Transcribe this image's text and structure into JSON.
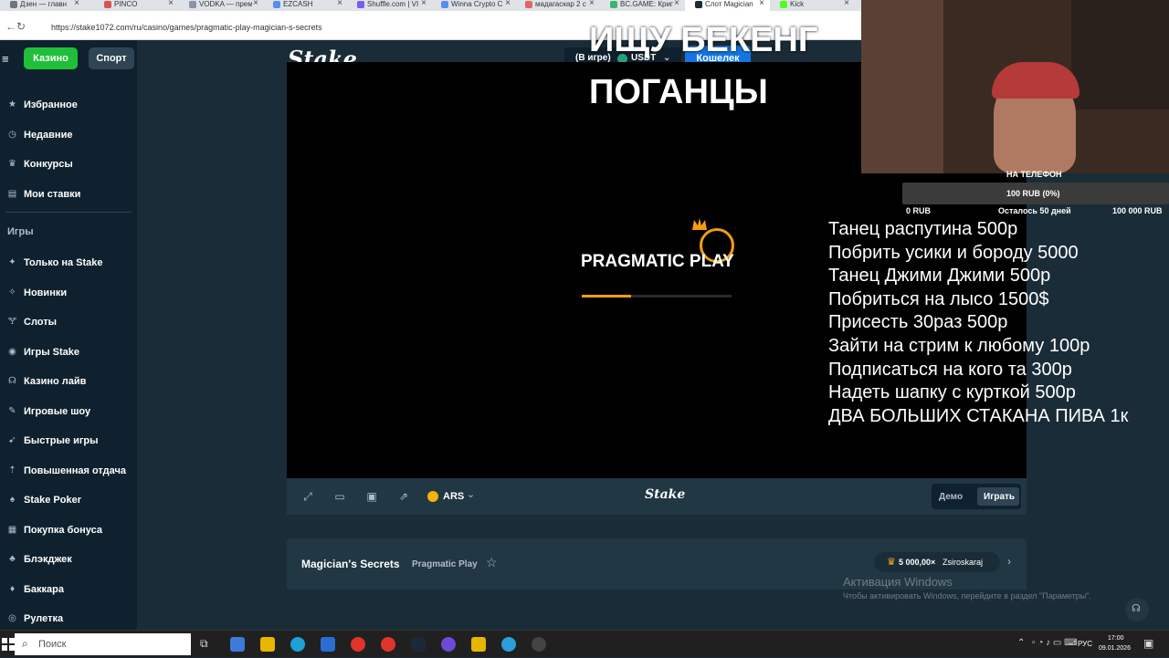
{
  "browser": {
    "tabs": [
      {
        "label": "Дзен — главн",
        "color": "#6f7680"
      },
      {
        "label": "PINCO",
        "color": "#d9534f"
      },
      {
        "label": "VODKA — прем",
        "color": "#8a94a6"
      },
      {
        "label": "EZCASH",
        "color": "#5b8def"
      },
      {
        "label": "Shuffle.com | VI",
        "color": "#7b5cf0"
      },
      {
        "label": "Winna Crypto C",
        "color": "#5b8def"
      },
      {
        "label": "мадагаскар 2 с",
        "color": "#e06666"
      },
      {
        "label": "BC.GAME: Крип",
        "color": "#3cb371"
      },
      {
        "label": "Слот Magician",
        "color": "#1a2c38"
      },
      {
        "label": "Kick",
        "color": "#53fc18"
      }
    ],
    "url": "https://stake1072.com/ru/casino/games/pragmatic-play-magician-s-secrets"
  },
  "site": {
    "casino_label": "Казино",
    "sport_label": "Спорт",
    "logo": "Stake",
    "balance_label": "(В игре)",
    "currency": "USDT",
    "wallet_label": "Кошелек",
    "nav_top": [
      {
        "label": "Избранное",
        "icon": "star-icon"
      },
      {
        "label": "Недавние",
        "icon": "clock-icon"
      },
      {
        "label": "Конкурсы",
        "icon": "trophy-icon"
      },
      {
        "label": "Мои ставки",
        "icon": "bets-icon"
      }
    ],
    "games_title": "Игры",
    "nav_games": [
      {
        "label": "Только на Stake",
        "icon": "stake-only-icon"
      },
      {
        "label": "Новинки",
        "icon": "sparkle-icon"
      },
      {
        "label": "Слоты",
        "icon": "slots-icon"
      },
      {
        "label": "Игры Stake",
        "icon": "stake-games-icon"
      },
      {
        "label": "Казино лайв",
        "icon": "live-casino-icon"
      },
      {
        "label": "Игровые шоу",
        "icon": "game-show-icon"
      },
      {
        "label": "Быстрые игры",
        "icon": "quick-games-icon"
      },
      {
        "label": "Повышенная отдача",
        "icon": "rtp-icon"
      },
      {
        "label": "Stake Poker",
        "icon": "poker-icon"
      },
      {
        "label": "Покупка бонуса",
        "icon": "bonus-buy-icon"
      },
      {
        "label": "Блэкджек",
        "icon": "blackjack-icon"
      },
      {
        "label": "Баккара",
        "icon": "baccarat-icon"
      },
      {
        "label": "Рулетка",
        "icon": "roulette-icon"
      }
    ],
    "game_loader_brand": "PRAGMATIC PLAY",
    "loader_progress": 0.33,
    "controls": {
      "currency": "ARS",
      "brand": "Stake",
      "demo_label": "Демо",
      "play_label": "Играть"
    },
    "game_title": "Magician's Secrets",
    "provider": "Pragmatic Play",
    "big_win": "5 000,00×",
    "big_win_user": "Zsiroskaraj"
  },
  "overlay": {
    "title_line1": "ИЩУ БЕКЕНГ",
    "title_line2": "ПОГАНЦЫ",
    "goal_title": "НА ТЕЛЕФОН",
    "goal_amount": "100 RUB (0%)",
    "goal_min": "0 RUB",
    "goal_days": "Осталось 50 дней",
    "goal_max": "100 000 RUB",
    "donate_list": [
      "Танец распутина 500р",
      "Побрить усики и бороду 5000",
      "Танец Джими Джими 500р",
      "Побриться на лысо 1500$",
      "Присесть 30раз 500р",
      "Зайти на стрим к любому 100р",
      "Подписаться на кого та 300р",
      "Надеть шапку с курткой 500р",
      "ДВА БОЛЬШИХ  СТАКАНА ПИВА 1к"
    ],
    "activation_title": "Активация Windows",
    "activation_sub": "Чтобы активировать Windows, перейдите в раздел \"Параметры\"."
  },
  "taskbar": {
    "search_label": "Поиск",
    "lang": "РУС",
    "time": "17:00",
    "date": "09.01.2026"
  }
}
